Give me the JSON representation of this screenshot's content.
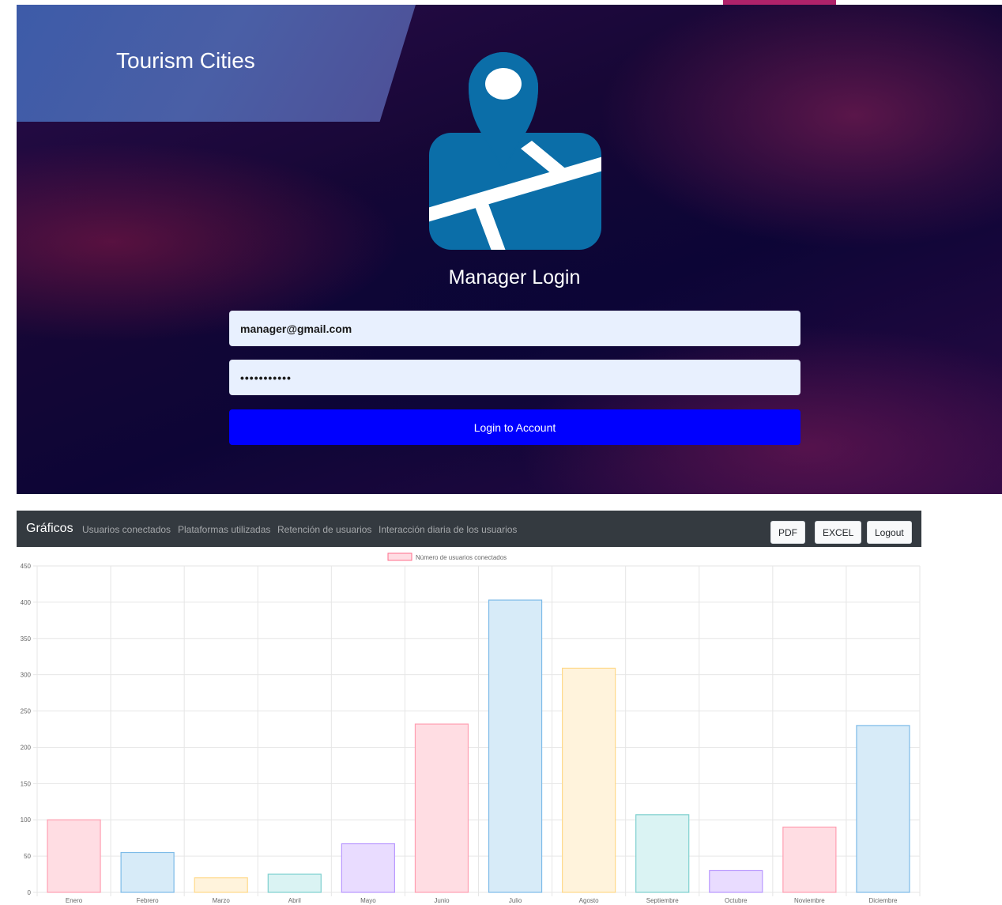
{
  "login": {
    "brand_title": "Tourism Cities",
    "heading": "Manager Login",
    "email_value": "manager@gmail.com",
    "password_value": "•••••••••••",
    "button_label": "Login to Account"
  },
  "dashboard": {
    "nav": {
      "brand": "Gráficos",
      "links": [
        "Usuarios conectados",
        "Plataformas utilizadas",
        "Retención de usuarios",
        "Interacción diaria de los usuarios"
      ],
      "buttons": [
        "PDF",
        "EXCEL",
        "Logout"
      ]
    }
  },
  "chart_data": {
    "type": "bar",
    "categories": [
      "Enero",
      "Febrero",
      "Marzo",
      "Abril",
      "Mayo",
      "Junio",
      "Julio",
      "Agosto",
      "Septiembre",
      "Octubre",
      "Noviembre",
      "Diciembre"
    ],
    "series": [
      {
        "name": "Número de usuarios conectados",
        "values": [
          100,
          55,
          20,
          25,
          67,
          232,
          403,
          309,
          107,
          30,
          90,
          230
        ]
      }
    ],
    "ylim": [
      0,
      450
    ],
    "yticks": [
      0,
      50,
      100,
      150,
      200,
      250,
      300,
      350,
      400,
      450
    ],
    "grid": true,
    "legend": "top-center",
    "bar_fill_colors": [
      "#ffdde3",
      "#d7ebf8",
      "#fff3dc",
      "#daf3f3",
      "#e9dcff"
    ],
    "bar_border_colors": [
      "#ff9fb2",
      "#7dbbe8",
      "#ffd98a",
      "#7fd0cf",
      "#b998ff"
    ],
    "legend_fill": "#ffdde3",
    "legend_border": "#ff6f8e"
  }
}
